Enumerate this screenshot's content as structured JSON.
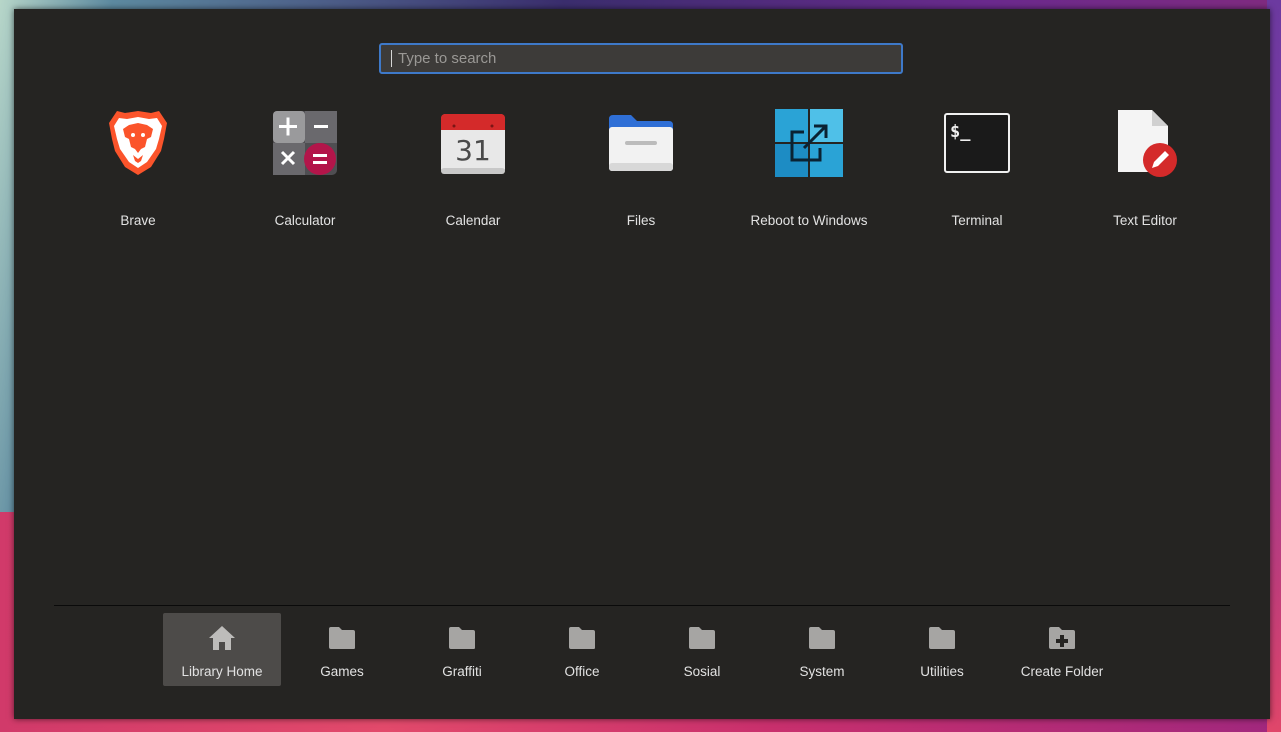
{
  "search": {
    "placeholder": "Type to search",
    "value": ""
  },
  "apps": [
    {
      "label": "Brave",
      "icon": "brave-lion-icon"
    },
    {
      "label": "Calculator",
      "icon": "calculator-icon"
    },
    {
      "label": "Calendar",
      "icon": "calendar-icon",
      "day": "31"
    },
    {
      "label": "Files",
      "icon": "folder-files-icon"
    },
    {
      "label": "Reboot to Windows",
      "icon": "windows-reboot-icon"
    },
    {
      "label": "Terminal",
      "icon": "terminal-icon",
      "prompt": "$_"
    },
    {
      "label": "Text Editor",
      "icon": "text-editor-icon"
    }
  ],
  "folders": [
    {
      "label": "Library Home",
      "icon": "home-icon",
      "active": true
    },
    {
      "label": "Games",
      "icon": "folder-icon"
    },
    {
      "label": "Graffiti",
      "icon": "folder-icon"
    },
    {
      "label": "Office",
      "icon": "folder-icon"
    },
    {
      "label": "Sosial",
      "icon": "folder-icon"
    },
    {
      "label": "System",
      "icon": "folder-icon"
    },
    {
      "label": "Utilities",
      "icon": "folder-icon"
    },
    {
      "label": "Create Folder",
      "icon": "create-folder-icon"
    }
  ],
  "colors": {
    "panel": "#252422",
    "accent": "#3e79c9",
    "active_folder": "#4d4b49",
    "brave_orange": "#fb542b",
    "calendar_red": "#d42a2a",
    "editor_red": "#d42a2a"
  }
}
